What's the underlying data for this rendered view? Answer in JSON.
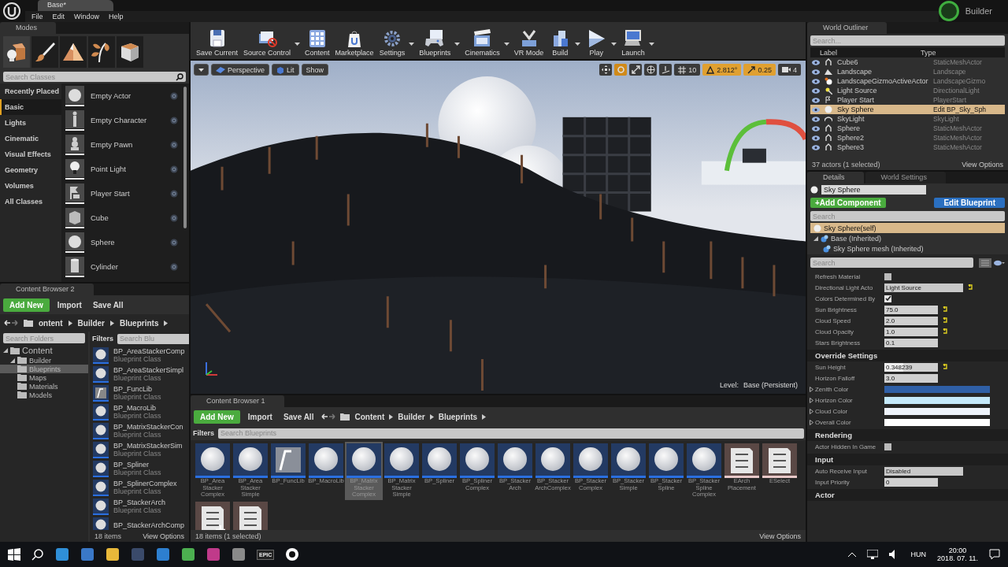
{
  "title_bar": {
    "tab": "Base*",
    "menu": [
      "File",
      "Edit",
      "Window",
      "Help"
    ],
    "project": "Builder"
  },
  "modes": {
    "tab": "Modes",
    "tools": [
      {
        "kind": "place",
        "selected": true
      },
      {
        "kind": "paint",
        "selected": false
      },
      {
        "kind": "landscape",
        "selected": false
      },
      {
        "kind": "foliage",
        "selected": false
      },
      {
        "kind": "geometry",
        "selected": false
      }
    ],
    "search": {
      "placeholder": "Search Classes"
    },
    "categories": [
      {
        "label": "Recently Placed",
        "selected": false
      },
      {
        "label": "Basic",
        "selected": true
      },
      {
        "label": "Lights",
        "selected": false
      },
      {
        "label": "Cinematic",
        "selected": false
      },
      {
        "label": "Visual Effects",
        "selected": false
      },
      {
        "label": "Geometry",
        "selected": false
      },
      {
        "label": "Volumes",
        "selected": false
      },
      {
        "label": "All Classes",
        "selected": false
      }
    ],
    "items": [
      {
        "label": "Empty Actor",
        "kind": "sphere"
      },
      {
        "label": "Empty Character",
        "kind": "figure"
      },
      {
        "label": "Empty Pawn",
        "kind": "pawn"
      },
      {
        "label": "Point Light",
        "kind": "bulb"
      },
      {
        "label": "Player Start",
        "kind": "flag"
      },
      {
        "label": "Cube",
        "kind": "cube"
      },
      {
        "label": "Sphere",
        "kind": "sphere"
      },
      {
        "label": "Cylinder",
        "kind": "cylinder"
      }
    ]
  },
  "toolbar": [
    {
      "label": "Save Current",
      "kind": "save",
      "dropdown": false
    },
    {
      "label": "Source Control",
      "kind": "source",
      "dropdown": true
    },
    {
      "label": "Content",
      "kind": "content",
      "dropdown": false
    },
    {
      "label": "Marketplace",
      "kind": "market",
      "dropdown": false
    },
    {
      "label": "Settings",
      "kind": "settings",
      "dropdown": true
    },
    {
      "label": "Blueprints",
      "kind": "blueprints",
      "dropdown": true
    },
    {
      "label": "Cinematics",
      "kind": "cinematics",
      "dropdown": true
    },
    {
      "label": "VR Mode",
      "kind": "vr",
      "dropdown": false
    },
    {
      "label": "Build",
      "kind": "build",
      "dropdown": true
    },
    {
      "label": "Play",
      "kind": "play",
      "dropdown": true
    },
    {
      "label": "Launch",
      "kind": "launch",
      "dropdown": true
    }
  ],
  "viewport": {
    "view_mode": "Perspective",
    "lighting": "Lit",
    "show": "Show",
    "transform_tools": [
      {
        "kind": "move",
        "selected": false
      },
      {
        "kind": "rotate",
        "selected": true
      },
      {
        "kind": "scale",
        "selected": false
      }
    ],
    "snaps": [
      {
        "kind": "grid",
        "value": "10",
        "on": false
      },
      {
        "kind": "rotation",
        "value": "2.812°",
        "on": true
      },
      {
        "kind": "scale",
        "value": "0.25",
        "on": true
      }
    ],
    "camera_speed": "4",
    "level_label": "Level:",
    "level": "Base (Persistent)"
  },
  "content_browser_2": {
    "tab": "Content Browser 2",
    "add_new": "Add New",
    "import": "Import",
    "save_all": "Save All",
    "path": [
      "ontent",
      "Builder",
      "Blueprints"
    ],
    "folder_search": {
      "placeholder": "Search Folders"
    },
    "folders": [
      {
        "label": "Content",
        "expanded": true,
        "selected": false,
        "children": [
          {
            "label": "Builder",
            "expanded": true,
            "selected": false,
            "children": [
              {
                "label": "Blueprints",
                "selected": true
              },
              {
                "label": "Maps",
                "selected": false
              },
              {
                "label": "Materials",
                "selected": false
              },
              {
                "label": "Models",
                "selected": false
              }
            ]
          }
        ]
      }
    ],
    "filters": "Filters",
    "asset_search": {
      "placeholder": "Search Blu"
    },
    "assets": [
      {
        "name": "BP_AreaStackerComp",
        "class": "Blueprint Class",
        "kind": "blueprint"
      },
      {
        "name": "BP_AreaStackerSimpl",
        "class": "Blueprint Class",
        "kind": "blueprint"
      },
      {
        "name": "BP_FuncLib",
        "class": "Blueprint Class",
        "kind": "function"
      },
      {
        "name": "BP_MacroLib",
        "class": "Blueprint Class",
        "kind": "blueprint"
      },
      {
        "name": "BP_MatrixStackerCon",
        "class": "Blueprint Class",
        "kind": "blueprint"
      },
      {
        "name": "BP_MatrixStackerSim",
        "class": "Blueprint Class",
        "kind": "blueprint"
      },
      {
        "name": "BP_Spliner",
        "class": "Blueprint Class",
        "kind": "blueprint"
      },
      {
        "name": "BP_SplinerComplex",
        "class": "Blueprint Class",
        "kind": "blueprint"
      },
      {
        "name": "BP_StackerArch",
        "class": "Blueprint Class",
        "kind": "blueprint"
      },
      {
        "name": "BP_StackerArchComp",
        "kind": "blueprint"
      }
    ],
    "item_count": "18 items",
    "view_options": "View Options"
  },
  "content_browser_1": {
    "tab": "Content Browser 1",
    "add_new": "Add New",
    "import": "Import",
    "save_all": "Save All",
    "path": [
      "Content",
      "Builder",
      "Blueprints"
    ],
    "filters": "Filters",
    "search": {
      "placeholder": "Search Blueprints"
    },
    "assets": [
      {
        "name": "BP_Area Stacker Complex",
        "kind": "blueprint",
        "selected": false
      },
      {
        "name": "BP_Area Stacker Simple",
        "kind": "blueprint",
        "selected": false
      },
      {
        "name": "BP_FuncLib",
        "kind": "function",
        "selected": false
      },
      {
        "name": "BP_MacroLib",
        "kind": "blueprint",
        "selected": false
      },
      {
        "name": "BP_Matrix Stacker Complex",
        "kind": "blueprint",
        "selected": true
      },
      {
        "name": "BP_Matrix Stacker Simple",
        "kind": "blueprint",
        "selected": false
      },
      {
        "name": "BP_Spliner",
        "kind": "blueprint",
        "selected": false
      },
      {
        "name": "BP_Spliner Complex",
        "kind": "blueprint",
        "selected": false
      },
      {
        "name": "BP_Stacker Arch",
        "kind": "blueprint",
        "selected": false
      },
      {
        "name": "BP_Stacker ArchComplex",
        "kind": "blueprint",
        "selected": false
      },
      {
        "name": "BP_Stacker Complex",
        "kind": "blueprint",
        "selected": false
      },
      {
        "name": "BP_Stacker Simple",
        "kind": "blueprint",
        "selected": false
      },
      {
        "name": "BP_Stacker Spline",
        "kind": "blueprint",
        "selected": false
      },
      {
        "name": "BP_Stacker Spline Complex",
        "kind": "blueprint",
        "selected": false
      },
      {
        "name": "EArch Placement",
        "kind": "list",
        "selected": false
      },
      {
        "name": "ESelect",
        "kind": "list",
        "selected": false
      },
      {
        "kind": "listadd",
        "selected": false
      },
      {
        "kind": "list",
        "selected": false
      }
    ],
    "item_count": "18 items (1 selected)",
    "view_options": "View Options"
  },
  "world_outliner": {
    "tab": "World Outliner",
    "search": {
      "placeholder": "Search..."
    },
    "columns": [
      "Label",
      "Type"
    ],
    "rows": [
      {
        "label": "Cube6",
        "type": "StaticMeshActor",
        "kind": "mesh",
        "selected": false
      },
      {
        "label": "Landscape",
        "type": "Landscape",
        "kind": "landscape",
        "selected": false
      },
      {
        "label": "LandscapeGizmoActiveActor",
        "type": "LandscapeGizmo",
        "kind": "gizmo",
        "selected": false
      },
      {
        "label": "Light Source",
        "type": "DirectionalLight",
        "kind": "light",
        "selected": false
      },
      {
        "label": "Player Start",
        "type": "PlayerStart",
        "kind": "start",
        "selected": false
      },
      {
        "label": "Sky Sphere",
        "type": "Edit BP_Sky_Sph",
        "kind": "sky",
        "selected": true
      },
      {
        "label": "SkyLight",
        "type": "SkyLight",
        "kind": "skylight",
        "selected": false
      },
      {
        "label": "Sphere",
        "type": "StaticMeshActor",
        "kind": "mesh",
        "selected": false
      },
      {
        "label": "Sphere2",
        "type": "StaticMeshActor",
        "kind": "mesh",
        "selected": false
      },
      {
        "label": "Sphere3",
        "type": "StaticMeshActor",
        "kind": "mesh",
        "selected": false
      }
    ],
    "status": "37 actors (1 selected)",
    "view_options": "View Options"
  },
  "details": {
    "tabs": [
      {
        "label": "Details",
        "selected": true
      },
      {
        "label": "World Settings",
        "selected": false
      }
    ],
    "actor_name": "Sky Sphere",
    "add_component": "+Add Component",
    "edit_blueprint": "Edit Blueprint",
    "component_search": {
      "placeholder": "Search"
    },
    "components": [
      {
        "label": "Sky Sphere(self)",
        "kind": "self",
        "selected": true
      },
      {
        "label": "Base (Inherited)",
        "kind": "scene",
        "selected": false,
        "expanded": true,
        "children": [
          {
            "label": "Sky Sphere mesh (Inherited)",
            "kind": "scene",
            "selected": false
          }
        ]
      }
    ],
    "property_search": {
      "placeholder": "Search"
    },
    "sections": [
      {
        "rows": [
          {
            "label": "Refresh Material",
            "kind": "checkbox",
            "checked": false
          },
          {
            "label": "Directional Light Acto",
            "kind": "dropdown",
            "value": "Light Source",
            "modified": true
          },
          {
            "label": "Colors Determined By",
            "kind": "checkbox",
            "checked": true
          },
          {
            "label": "Sun Brightness",
            "kind": "number",
            "value": "75.0",
            "modified": true
          },
          {
            "label": "Cloud Speed",
            "kind": "number",
            "value": "2.0",
            "modified": true
          },
          {
            "label": "Cloud Opacity",
            "kind": "number",
            "value": "1.0",
            "modified": true
          },
          {
            "label": "Stars Brightness",
            "kind": "number",
            "value": "0.1",
            "modified": false
          }
        ]
      },
      {
        "title": "Override Settings",
        "rows": [
          {
            "label": "Sun Height",
            "kind": "slider",
            "value": "0.348239",
            "level": 0.35,
            "modified": true
          },
          {
            "label": "Horizon Falloff",
            "kind": "number",
            "value": "3.0",
            "modified": false
          },
          {
            "label": "Zenith Color",
            "kind": "color",
            "color": "#2f5fa6"
          },
          {
            "label": "Horizon Color",
            "kind": "color",
            "color": "#c4e9fb"
          },
          {
            "label": "Cloud Color",
            "kind": "color",
            "color": "#eef3fb"
          },
          {
            "label": "Overall Color",
            "kind": "color",
            "color": "#ffffff"
          }
        ]
      },
      {
        "title": "Rendering",
        "rows": [
          {
            "label": "Actor Hidden In Game",
            "kind": "checkbox",
            "checked": false
          }
        ]
      },
      {
        "title": "Input",
        "rows": [
          {
            "label": "Auto Receive Input",
            "kind": "dropdown",
            "value": "Disabled",
            "modified": false
          },
          {
            "label": "Input Priority",
            "kind": "number",
            "value": "0",
            "modified": false
          }
        ]
      },
      {
        "title": "Actor"
      }
    ]
  },
  "taskbar": {
    "epic_label": "EPIC",
    "language": "HUN",
    "time": "20:00",
    "date": "2018. 07. 11."
  }
}
